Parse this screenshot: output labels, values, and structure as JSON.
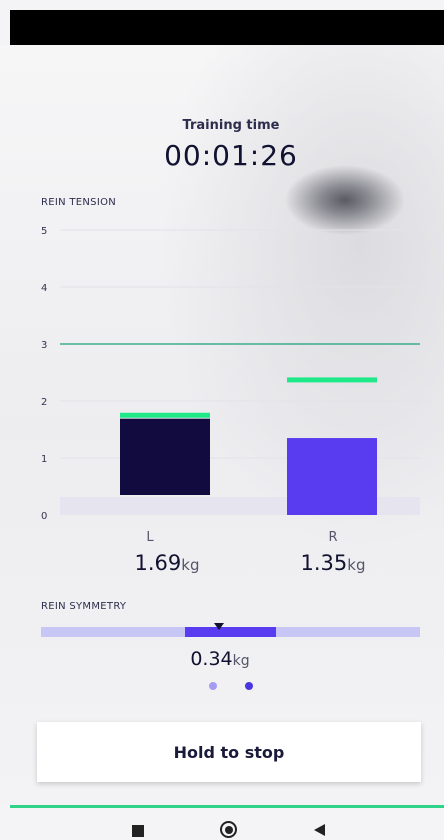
{
  "header": {
    "label": "Training time",
    "time": "00:01:26"
  },
  "rein_tension": {
    "label": "REIN TENSION",
    "chart_data": {
      "type": "bar",
      "categories": [
        "L",
        "R"
      ],
      "values": [
        1.69,
        1.35
      ],
      "targets": [
        1.75,
        2.37
      ],
      "ylim": [
        0,
        5
      ],
      "yticks": [
        "0",
        "1",
        "2",
        "3",
        "4",
        "5"
      ],
      "reference_line": 3,
      "grid": true,
      "colors": {
        "L": "#120b40",
        "R": "#5a3cf0",
        "target": "#1fe888",
        "reference": "#1a9e7a"
      }
    },
    "readouts": [
      {
        "side": "L",
        "value": "1.69",
        "unit": "kg"
      },
      {
        "side": "R",
        "value": "1.35",
        "unit": "kg"
      }
    ]
  },
  "rein_symmetry": {
    "label": "REIN SYMMETRY",
    "value": "0.34",
    "unit": "kg",
    "colors": {
      "track": "#c8c6f4",
      "fill": "#5a3cf0",
      "dot_light": "#a49cf0",
      "dot_dark": "#4a36e0"
    }
  },
  "stop_button": {
    "label": "Hold to stop"
  },
  "colors": {
    "accent_green": "#2fd48a"
  },
  "nav": {
    "icons": [
      "recent-apps-icon",
      "home-icon",
      "back-icon"
    ]
  }
}
